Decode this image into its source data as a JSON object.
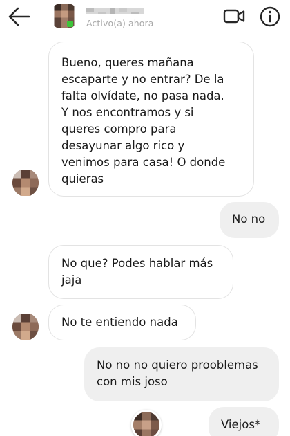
{
  "header": {
    "status": "Activo(a) ahora",
    "back_icon": "arrow-left-icon",
    "video_icon": "video-call-icon",
    "info_icon": "info-icon",
    "online_color": "#3ec43a"
  },
  "messages": [
    {
      "direction": "incoming",
      "text": "Bueno, queres mañana\nescaparte y no entrar? De la\nfalta olvídate, no pasa nada.\nY nos encontramos y si\nqueres compro para\ndesayunar algo rico y\nvenimos para casa! O donde\nquieras"
    },
    {
      "direction": "outgoing",
      "text": "No no"
    },
    {
      "direction": "incoming",
      "text": "No que? Podes hablar más\njaja"
    },
    {
      "direction": "incoming",
      "text": "No te entiendo nada"
    },
    {
      "direction": "outgoing",
      "text": "No no no quiero proob​lemas\ncon mis     joso"
    },
    {
      "direction": "outgoing",
      "text": "Viejos*"
    }
  ],
  "colors": {
    "outgoing_bubble": "#efefef",
    "incoming_border": "#e3e3e3",
    "status_text": "#a8a8a8"
  }
}
